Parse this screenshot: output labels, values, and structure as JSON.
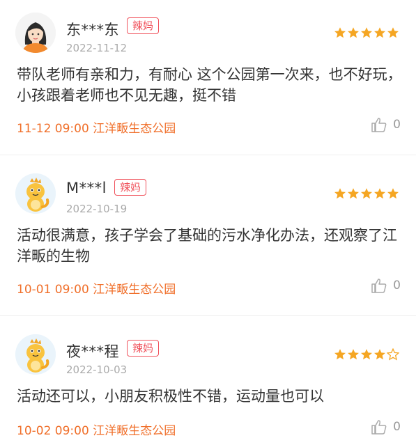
{
  "reviews": [
    {
      "user": "东***东",
      "badge": "辣妈",
      "date": "2022-11-12",
      "rating": 5,
      "content": "带队老师有亲和力，有耐心 这个公园第一次来，也不好玩，小孩跟着老师也不见无趣，挺不错",
      "time": "11-12 09:00",
      "place": "江洋畈生态公园",
      "likes": "0",
      "avatar_icon": "woman-avatar-icon"
    },
    {
      "user": "M***l",
      "badge": "辣妈",
      "date": "2022-10-19",
      "rating": 5,
      "content": "活动很满意，孩子学会了基础的污水净化办法，还观察了江洋畈的生物",
      "time": "10-01 09:00",
      "place": "江洋畈生态公园",
      "likes": "0",
      "avatar_icon": "dinosaur-avatar-icon"
    },
    {
      "user": "夜***程",
      "badge": "辣妈",
      "date": "2022-10-03",
      "rating": 4,
      "content": "活动还可以，小朋友积极性不错，运动量也可以",
      "time": "10-02 09:00",
      "place": "江洋畈生态公园",
      "likes": "0",
      "avatar_icon": "dinosaur-avatar-icon"
    }
  ],
  "colors": {
    "star": "#f5a623",
    "badge": "#f0525c",
    "meta": "#f06f2a"
  }
}
